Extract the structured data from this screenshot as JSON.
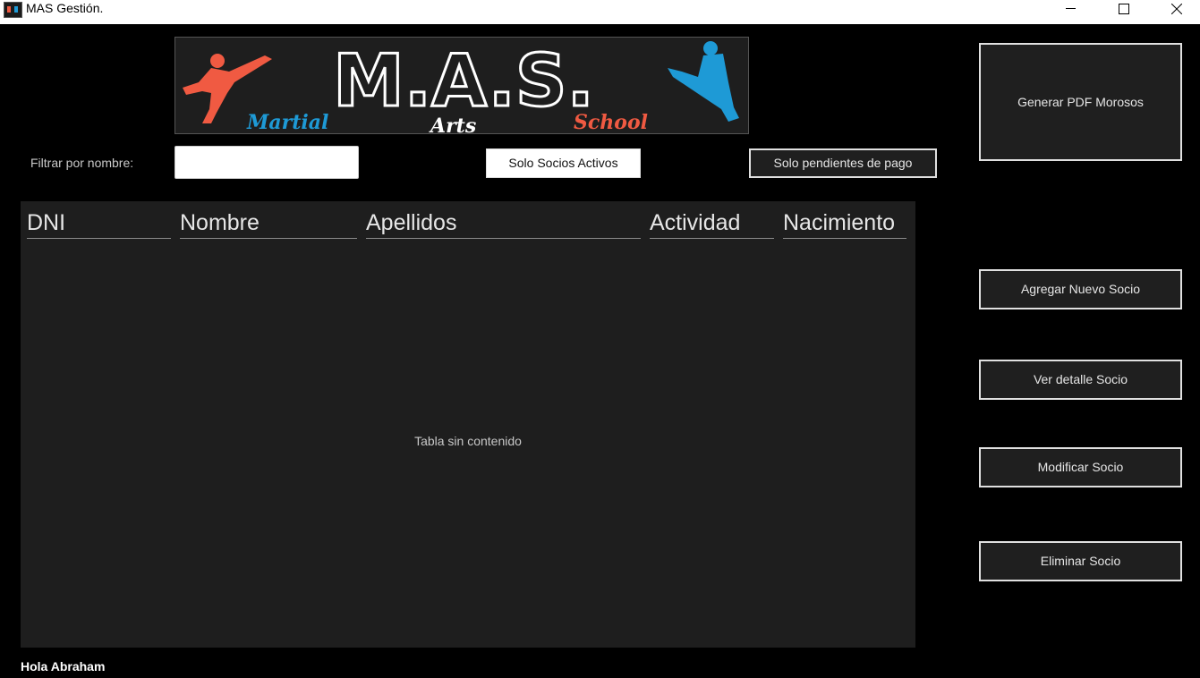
{
  "window": {
    "title": "MAS Gestión."
  },
  "logo": {
    "initials": "M.A.S.",
    "word1": "Martial",
    "word2": "Arts",
    "word3": "School",
    "colors": {
      "red": "#f05a42",
      "blue": "#1e9ad6"
    }
  },
  "filter": {
    "label": "Filtrar por nombre:",
    "value": "",
    "placeholder": ""
  },
  "buttons": {
    "active_members": "Solo Socios Activos",
    "pending_payment": "Solo pendientes de pago",
    "generate_pdf": "Generar PDF Morosos",
    "add_member": "Agregar Nuevo Socio",
    "view_member": "Ver detalle Socio",
    "edit_member": "Modificar Socio",
    "delete_member": "Eliminar Socio"
  },
  "table": {
    "columns": [
      "DNI",
      "Nombre",
      "Apellidos",
      "Actividad",
      "Nacimiento"
    ],
    "rows": [],
    "empty_message": "Tabla sin contenido"
  },
  "status": {
    "greeting": "Hola Abraham"
  },
  "colors": {
    "background": "#000000",
    "panel": "#1e1e1e",
    "button_border": "#e0e0e0"
  }
}
